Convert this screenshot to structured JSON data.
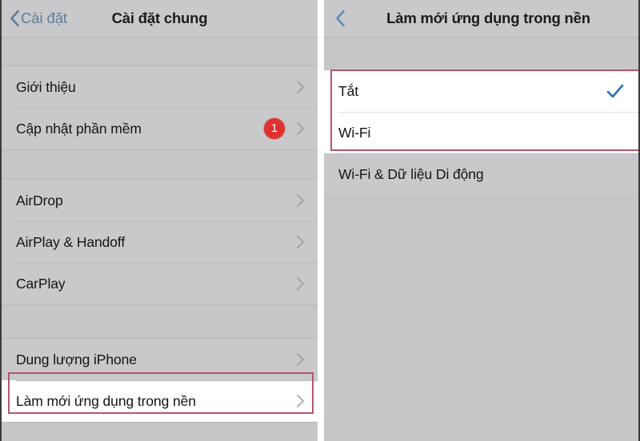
{
  "left_panel": {
    "nav": {
      "back_label": "Cài đặt",
      "back_icon": "chevron-left-icon",
      "title": "Cài đặt chung"
    },
    "groups": [
      {
        "items": [
          {
            "label": "Giới thiệu",
            "accessory": "chevron-right-icon",
            "badge": null
          },
          {
            "label": "Cập nhật phần mềm",
            "accessory": "chevron-right-icon",
            "badge": "1"
          }
        ]
      },
      {
        "items": [
          {
            "label": "AirDrop",
            "accessory": "chevron-right-icon",
            "badge": null
          },
          {
            "label": "AirPlay & Handoff",
            "accessory": "chevron-right-icon",
            "badge": null
          },
          {
            "label": "CarPlay",
            "accessory": "chevron-right-icon",
            "badge": null
          }
        ]
      },
      {
        "items": [
          {
            "label": "Dung lượng iPhone",
            "accessory": "chevron-right-icon",
            "badge": null
          },
          {
            "label": "Làm mới ứng dụng trong nền",
            "accessory": "chevron-right-icon",
            "badge": null
          }
        ]
      }
    ]
  },
  "right_panel": {
    "nav": {
      "back_icon": "chevron-left-icon",
      "title": "Làm mới ứng dụng trong nền"
    },
    "options": [
      {
        "label": "Tắt",
        "selected": true,
        "accessory": "checkmark-icon"
      },
      {
        "label": "Wi-Fi",
        "selected": false,
        "accessory": null
      },
      {
        "label": "Wi-Fi & Dữ liệu Di động",
        "selected": false,
        "accessory": null
      }
    ]
  },
  "annotations": {
    "highlight_color": "#b5566b",
    "left_highlight_target": "Làm mới ứng dụng trong nền",
    "right_highlight_targets": "Tắt, Wi-Fi"
  },
  "colors": {
    "background": "#c6c6c9",
    "row_background": "#c9c9cc",
    "accent_blue": "#2b6fb5",
    "back_link": "#5d7d99",
    "badge_red": "#e03131",
    "highlight_red": "#b5566b",
    "selected_row_background": "#ffffff"
  }
}
